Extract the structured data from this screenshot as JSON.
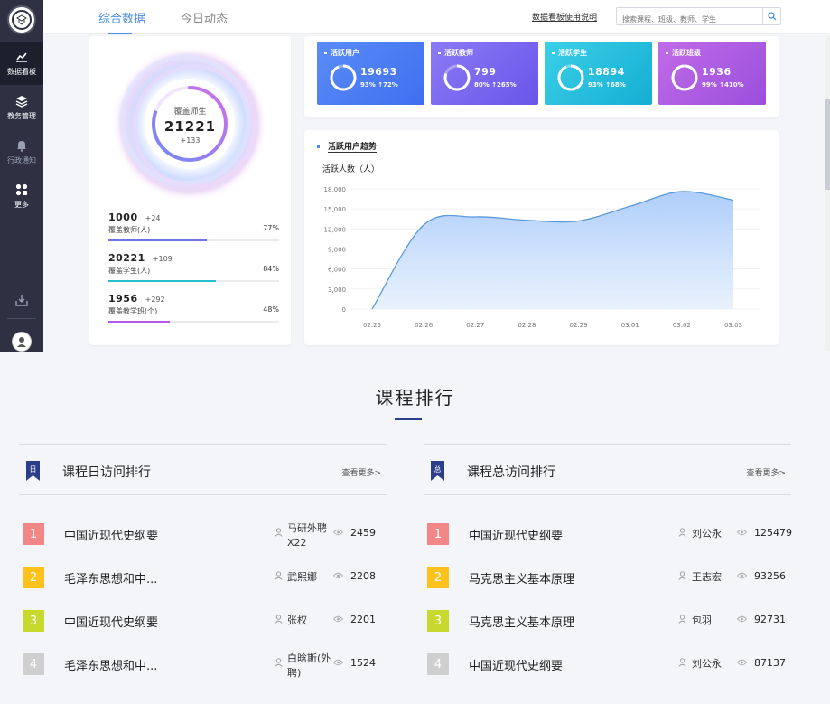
{
  "colors": {
    "accent": "#4a90e2",
    "sidebar": "#2f3142",
    "metric1": "#4d7cf5",
    "metric2": "#7d6bf0",
    "metric3": "#27c0dc",
    "metric4": "#b15de6",
    "rank1": "#f38686",
    "rank2": "#fcc11b",
    "rank3": "#c6d92c",
    "rank4": "#cfcfcf"
  },
  "sidebar": {
    "items": [
      {
        "label": "数据看板",
        "icon": "chart-icon"
      },
      {
        "label": "教务管理",
        "icon": "layers-icon"
      },
      {
        "label": "行政通知",
        "icon": "bell-icon"
      },
      {
        "label": "更多",
        "icon": "grid-icon"
      }
    ]
  },
  "header": {
    "tabs": [
      "综合数据",
      "今日动态"
    ],
    "help_link": "数据看板使用说明",
    "search_placeholder": "搜索课程、班级、教师、学生"
  },
  "coverage": {
    "label": "覆盖师生",
    "value": "21221",
    "delta": "+133",
    "stats": [
      {
        "num": "1000",
        "delta": "+24",
        "label": "覆盖教师(人)",
        "pct": "77%",
        "pct_value": 77,
        "color": "#6f72e8"
      },
      {
        "num": "20221",
        "delta": "+109",
        "label": "覆盖学生(人)",
        "pct": "84%",
        "pct_value": 84,
        "color": "#26bfcf"
      },
      {
        "num": "1956",
        "delta": "+292",
        "label": "覆盖教学班(个)",
        "pct": "48%",
        "pct_value": 48,
        "color": "#b35be6"
      }
    ]
  },
  "metrics": [
    {
      "title": "活跃用户",
      "value": "19693",
      "sub": "93% ↑72%",
      "ring_pct": 93
    },
    {
      "title": "活跃教师",
      "value": "799",
      "sub": "80% ↑265%",
      "ring_pct": 80
    },
    {
      "title": "活跃学生",
      "value": "18894",
      "sub": "93% ↑68%",
      "ring_pct": 93
    },
    {
      "title": "活跃班级",
      "value": "1936",
      "sub": "99% ↑410%",
      "ring_pct": 99
    }
  ],
  "chart_data": {
    "type": "area",
    "title": "活跃用户趋势",
    "ylabel": "活跃人数（人）",
    "xlabel": "",
    "x": [
      "02.25",
      "02.26",
      "02.27",
      "02.28",
      "02.29",
      "03.01",
      "03.02",
      "03.03"
    ],
    "y_ticks": [
      "18,000",
      "15,000",
      "12,000",
      "9,000",
      "6,000",
      "3,000",
      "0"
    ],
    "ylim": [
      0,
      18000
    ],
    "series": [
      {
        "values": [
          0,
          12600,
          13800,
          13300,
          13200,
          15400,
          17600,
          16300
        ]
      }
    ],
    "grid": true
  },
  "ranking": {
    "section_title": "课程排行",
    "more_label": "查看更多>",
    "daily": {
      "badge": "日",
      "title": "课程日访问排行",
      "rows": [
        {
          "rank": "1",
          "course": "中国近现代史纲要",
          "teacher": "马研外聘\nX22",
          "count": "2459"
        },
        {
          "rank": "2",
          "course": "毛泽东思想和中...",
          "teacher": "武熙娜",
          "count": "2208"
        },
        {
          "rank": "3",
          "course": "中国近现代史纲要",
          "teacher": "张权",
          "count": "2201"
        },
        {
          "rank": "4",
          "course": "毛泽东思想和中...",
          "teacher": "白晗斯(外\n聘)",
          "count": "1524"
        }
      ]
    },
    "total": {
      "badge": "总",
      "title": "课程总访问排行",
      "rows": [
        {
          "rank": "1",
          "course": "中国近现代史纲要",
          "teacher": "刘公永",
          "count": "125479"
        },
        {
          "rank": "2",
          "course": "马克思主义基本原理",
          "teacher": "王志宏",
          "count": "93256"
        },
        {
          "rank": "3",
          "course": "马克思主义基本原理",
          "teacher": "包羽",
          "count": "92731"
        },
        {
          "rank": "4",
          "course": "中国近现代史纲要",
          "teacher": "刘公永",
          "count": "87137"
        }
      ]
    }
  }
}
